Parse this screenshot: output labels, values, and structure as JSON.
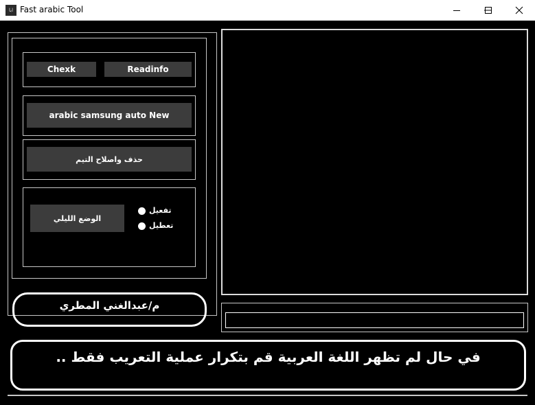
{
  "window": {
    "title": "Fast arabic Tool",
    "icon_text": "ابا",
    "minimize_icon": "minimize-icon",
    "maximize_icon": "maximize-icon",
    "close_icon": "close-icon"
  },
  "buttons": {
    "check": "Chexk",
    "readinfo": "Readinfo",
    "samsung": "arabic samsung auto New",
    "fix": "حذف واصلاح التيم",
    "night_mode": "الوضع الليلي"
  },
  "radios": {
    "enable": "تفعيل",
    "disable": "تعطيل"
  },
  "author": "م/عبدالغني المطري",
  "notice": "في حال لم تظهر اللغة العربية قم بتكرار عملية التعريب فقط ..",
  "output_field": {
    "value": ""
  },
  "colors": {
    "background": "#000000",
    "button": "#3c3c3c",
    "border": "#c8c8c8"
  }
}
